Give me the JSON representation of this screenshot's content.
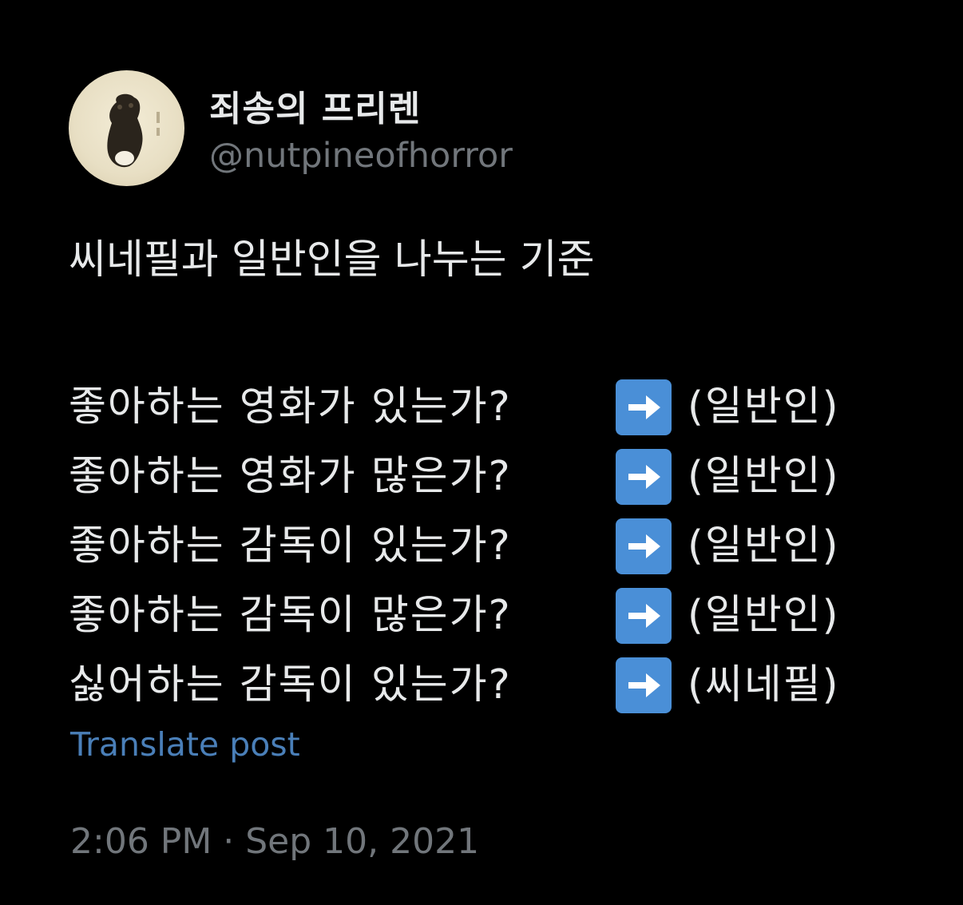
{
  "post": {
    "author": {
      "display_name": "죄송의 프리렌",
      "handle": "@nutpineofhorror",
      "avatar_icon": "profile-photo"
    },
    "title": "씨네필과 일반인을 나누는 기준",
    "lines": [
      {
        "question": "좋아하는 영화가 있는가?",
        "icon": "right-arrow-emoji",
        "result": "(일반인)"
      },
      {
        "question": "좋아하는 영화가 많은가?",
        "icon": "right-arrow-emoji",
        "result": "(일반인)"
      },
      {
        "question": "좋아하는 감독이 있는가?",
        "icon": "right-arrow-emoji",
        "result": "(일반인)"
      },
      {
        "question": "좋아하는 감독이 많은가?",
        "icon": "right-arrow-emoji",
        "result": "(일반인)"
      },
      {
        "question": "싫어하는 감독이 있는가?",
        "icon": "right-arrow-emoji",
        "result": "(씨네필)"
      }
    ],
    "translate_label": "Translate post",
    "timestamp": "2:06 PM · Sep 10, 2021"
  },
  "colors": {
    "background": "#000000",
    "primary_text": "#e7e9ea",
    "secondary_text": "#71767b",
    "link": "#4a7fb8",
    "arrow_emoji_bg": "#4a8fd7"
  }
}
